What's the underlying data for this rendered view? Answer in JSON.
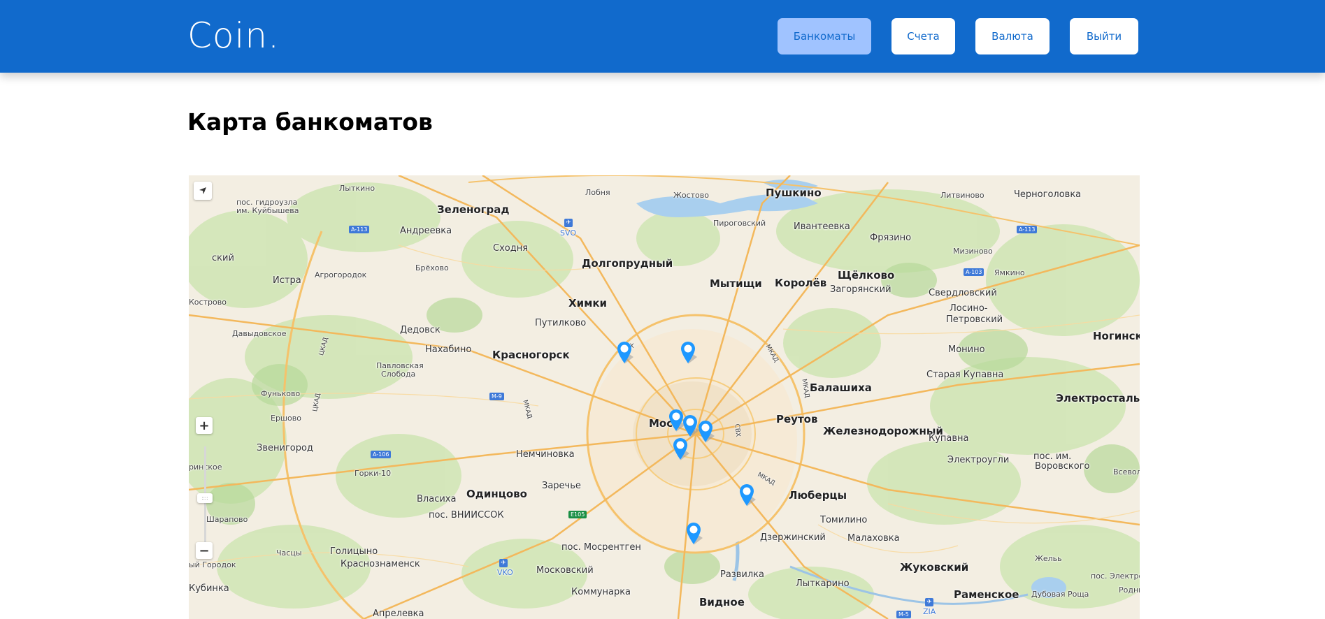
{
  "app": {
    "logo": "Coin."
  },
  "nav": {
    "items": [
      {
        "label": "Банкоматы",
        "active": true
      },
      {
        "label": "Счета",
        "active": false
      },
      {
        "label": "Валюта",
        "active": false
      },
      {
        "label": "Выйти",
        "active": false
      }
    ]
  },
  "page": {
    "title": "Карта банкоматов"
  },
  "map": {
    "labels": [
      {
        "text": "Лыткино",
        "kind": "small"
      },
      {
        "text": "Лобня",
        "kind": "small"
      },
      {
        "text": "Жостово",
        "kind": "small"
      },
      {
        "text": "Пушкино",
        "kind": "city"
      },
      {
        "text": "Литвиново",
        "kind": "small"
      },
      {
        "text": "Черноголовка",
        "kind": "town"
      },
      {
        "text": "пос. гидроузла",
        "kind": "small"
      },
      {
        "text": "им. Куйбышева",
        "kind": "small"
      },
      {
        "text": "Зеленоград",
        "kind": "city"
      },
      {
        "text": "Андреевка",
        "kind": "town"
      },
      {
        "text": "Сходня",
        "kind": "town"
      },
      {
        "text": "Пироговский",
        "kind": "small"
      },
      {
        "text": "Ивантеевка",
        "kind": "town"
      },
      {
        "text": "Фрязино",
        "kind": "town"
      },
      {
        "text": "Мизиново",
        "kind": "small"
      },
      {
        "text": "Брёхово",
        "kind": "small"
      },
      {
        "text": "Долгопрудный",
        "kind": "city"
      },
      {
        "text": "Истра",
        "kind": "town"
      },
      {
        "text": "Агрогородок",
        "kind": "small"
      },
      {
        "text": "Мытищи",
        "kind": "city"
      },
      {
        "text": "Королёв",
        "kind": "city"
      },
      {
        "text": "Щёлково",
        "kind": "city"
      },
      {
        "text": "Загорянский",
        "kind": "town"
      },
      {
        "text": "Свердловский",
        "kind": "town"
      },
      {
        "text": "Ямкино",
        "kind": "small"
      },
      {
        "text": "Химки",
        "kind": "city"
      },
      {
        "text": "Путилково",
        "kind": "town"
      },
      {
        "text": "Лосино-",
        "kind": "town"
      },
      {
        "text": "Петровский",
        "kind": "town"
      },
      {
        "text": "Дедовск",
        "kind": "town"
      },
      {
        "text": "Давыдовское",
        "kind": "small"
      },
      {
        "text": "Нахабино",
        "kind": "town"
      },
      {
        "text": "Красногорск",
        "kind": "city"
      },
      {
        "text": "Монино",
        "kind": "town"
      },
      {
        "text": "Ногинск",
        "kind": "city"
      },
      {
        "text": "Павловская",
        "kind": "small"
      },
      {
        "text": "Слобода",
        "kind": "small"
      },
      {
        "text": "Старая Купавна",
        "kind": "town"
      },
      {
        "text": "Балашиха",
        "kind": "city"
      },
      {
        "text": "Электросталь",
        "kind": "city"
      },
      {
        "text": "Фуньково",
        "kind": "small"
      },
      {
        "text": "Мос",
        "kind": "city"
      },
      {
        "text": "Реутов",
        "kind": "city"
      },
      {
        "text": "Ершово",
        "kind": "small"
      },
      {
        "text": "Железнодорожный",
        "kind": "city"
      },
      {
        "text": "Купавна",
        "kind": "town"
      },
      {
        "text": "Звенигород",
        "kind": "town"
      },
      {
        "text": "Немчиновка",
        "kind": "town"
      },
      {
        "text": "Электроугли",
        "kind": "town"
      },
      {
        "text": "пос. им.",
        "kind": "town"
      },
      {
        "text": "Воровского",
        "kind": "town"
      },
      {
        "text": "Всеволо",
        "kind": "small"
      },
      {
        "text": "Горки-10",
        "kind": "small"
      },
      {
        "text": "Одинцово",
        "kind": "city"
      },
      {
        "text": "Заречье",
        "kind": "town"
      },
      {
        "text": "Люберцы",
        "kind": "city"
      },
      {
        "text": "Власиха",
        "kind": "town"
      },
      {
        "text": "пос. ВНИИССОК",
        "kind": "town"
      },
      {
        "text": "Томилино",
        "kind": "town"
      },
      {
        "text": "Шарапово",
        "kind": "small"
      },
      {
        "text": "Дзержинский",
        "kind": "town"
      },
      {
        "text": "Малаховка",
        "kind": "town"
      },
      {
        "text": "Голицыно",
        "kind": "town"
      },
      {
        "text": "пос. Мосрентген",
        "kind": "town"
      },
      {
        "text": "Часцы",
        "kind": "small"
      },
      {
        "text": "Краснознаменск",
        "kind": "town"
      },
      {
        "text": "Жуковский",
        "kind": "city"
      },
      {
        "text": "Жельь",
        "kind": "small"
      },
      {
        "text": "Московский",
        "kind": "town"
      },
      {
        "text": "Развилка",
        "kind": "town"
      },
      {
        "text": "Лыткарино",
        "kind": "town"
      },
      {
        "text": "Раменское",
        "kind": "city"
      },
      {
        "text": "Коммунарка",
        "kind": "town"
      },
      {
        "text": "Видное",
        "kind": "city"
      },
      {
        "text": "Апрелевка",
        "kind": "town"
      },
      {
        "text": "Кубинка",
        "kind": "town"
      },
      {
        "text": "ский",
        "kind": "town"
      },
      {
        "text": "Кострово",
        "kind": "small"
      },
      {
        "text": "ринское",
        "kind": "small"
      },
      {
        "text": "ый Городок",
        "kind": "small"
      },
      {
        "text": "Дубовая Роща",
        "kind": "small"
      },
      {
        "text": "Родники",
        "kind": "small"
      },
      {
        "text": "пос. Электроизо",
        "kind": "small"
      }
    ],
    "highways": [
      "A-113",
      "A-113",
      "A-103",
      "M-9",
      "A-106",
      "E105",
      "M-5"
    ],
    "airports": [
      "SVO",
      "VKO",
      "ZIA"
    ],
    "road_labels": [
      "СВХ",
      "МКАД",
      "МКАД",
      "ЦКАД",
      "ЦКАД",
      "МКАД",
      "МКАД",
      "СВХ"
    ],
    "marker_count": 9
  }
}
